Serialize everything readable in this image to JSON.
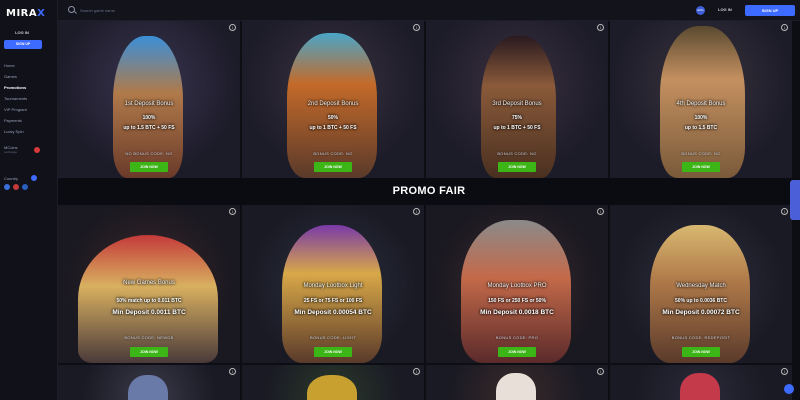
{
  "brand": {
    "logo_text": "MIRAX"
  },
  "sidebar": {
    "login": "LOG IN",
    "signup": "SIGN UP",
    "items": [
      {
        "label": "Home"
      },
      {
        "label": "Games"
      },
      {
        "label": "Promotions"
      },
      {
        "label": "Tournaments"
      },
      {
        "label": "VIP Program"
      },
      {
        "label": "Payments"
      },
      {
        "label": "Lucky Spin"
      }
    ],
    "active_item": "Promotions",
    "mcoins": "MCoins",
    "mcoins_sub": "exchange",
    "country": "Country"
  },
  "topbar": {
    "search_placeholder": "Search game name",
    "lang": "ENG",
    "login": "LOG IN",
    "signup": "SIGN UP"
  },
  "section_title": "PROMO FAIR",
  "row1": [
    {
      "title": "1st Deposit Bonus",
      "pct": "100%",
      "detail": "up to 1.5 BTC + 50 FS",
      "code": "NO BONUS CODE: NO",
      "cta": "JOIN NOW"
    },
    {
      "title": "2nd Deposit Bonus",
      "pct": "50%",
      "detail": "up to 1 BTC + 50 FS",
      "code": "BONUS CODE: NO",
      "cta": "JOIN NOW"
    },
    {
      "title": "3rd Deposit Bonus",
      "pct": "75%",
      "detail": "up to 1 BTC + 50 FS",
      "code": "BONUS CODE: NO",
      "cta": "JOIN NOW"
    },
    {
      "title": "4th Deposit Bonus",
      "pct": "100%",
      "detail": "up to 1.5 BTC",
      "code": "BONUS CODE: NO",
      "cta": "JOIN NOW"
    }
  ],
  "row2": [
    {
      "title": "New Games Bonus",
      "line1": "50% match up to 0.011 BTC",
      "line2": "Min Deposit 0.0011 BTC",
      "code": "BONUS CODE: NEWGB",
      "cta": "JOIN NOW"
    },
    {
      "title": "Monday Lootbox Light",
      "line1": "25 FS or 75 FS or 100 FS",
      "line2": "Min Deposit 0.00054 BTC",
      "code": "BONUS CODE: LIGHT",
      "cta": "JOIN NOW"
    },
    {
      "title": "Monday Lootbox PRO",
      "line1": "150 FS or 250 FS or 50%",
      "line2": "Min Deposit 0.0018 BTC",
      "code": "BONUS CODE: PRO",
      "cta": "JOIN NOW"
    },
    {
      "title": "Wednesday Match",
      "line1": "50% up to 0.0036 BTC",
      "line2": "Min Deposit 0.00072 BTC",
      "code": "BONUS CODE: REDEPOSIT",
      "cta": "JOIN NOW"
    }
  ],
  "colors": {
    "accent": "#3d6bff",
    "cta": "#3cb517",
    "bg": "#0d0e14"
  }
}
